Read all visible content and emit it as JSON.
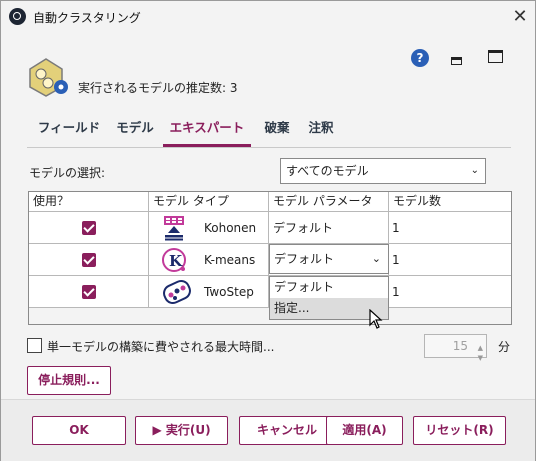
{
  "window": {
    "title": "自動クラスタリング",
    "close": "✕"
  },
  "header": {
    "estimate_text": "実行されるモデルの推定数: 3",
    "help_symbol": "?"
  },
  "tabs": [
    {
      "label": "フィールド"
    },
    {
      "label": "モデル"
    },
    {
      "label": "エキスパート"
    },
    {
      "label": "破棄"
    },
    {
      "label": "注釈"
    }
  ],
  "model_select": {
    "label": "モデルの選択:",
    "value": "すべてのモデル"
  },
  "table": {
    "headers": [
      "使用？",
      "モデル タイプ",
      "モデル パラメータ",
      "モデル数"
    ],
    "rows": [
      {
        "use": true,
        "type": "Kohonen",
        "params": "デフォルト",
        "count": "1"
      },
      {
        "use": true,
        "type": "K-means",
        "params": "デフォルト",
        "count": "1"
      },
      {
        "use": true,
        "type": "TwoStep",
        "params": "デフォルト",
        "count": "1"
      }
    ]
  },
  "dropdown_options": [
    "デフォルト",
    "指定..."
  ],
  "max_time": {
    "label": "単一モデルの構築に費やされる最大時間...",
    "value": "15",
    "unit": "分"
  },
  "buttons": {
    "stop_rules": "停止規則...",
    "ok": "OK",
    "run": "▶ 実行(U)",
    "cancel": "キャンセル",
    "apply": "適用(A)",
    "reset": "リセット(R)"
  },
  "colors": {
    "accent": "#8a1e5c",
    "help": "#2a5fb6"
  }
}
